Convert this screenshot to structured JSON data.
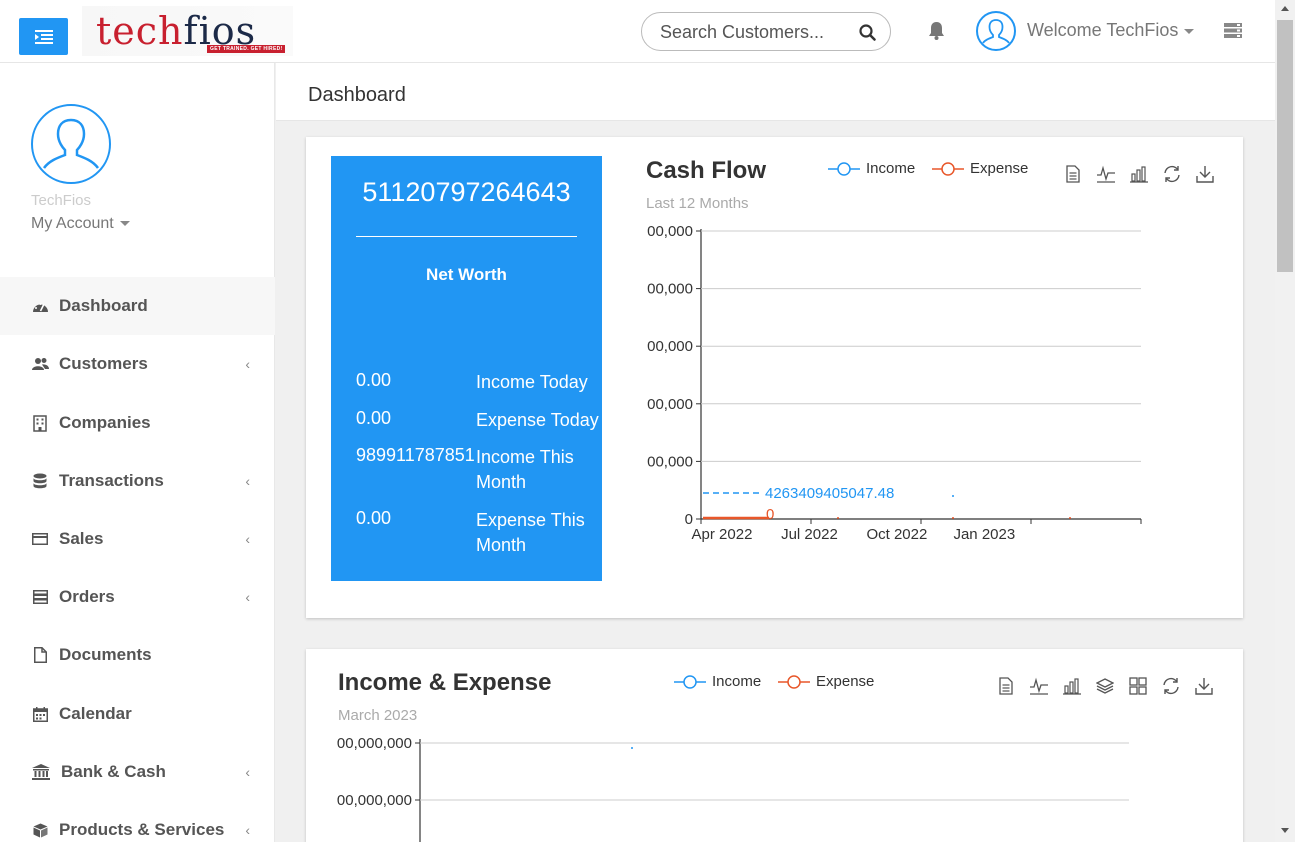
{
  "header": {
    "logo_tech": "tech",
    "logo_fios": "fios",
    "logo_tagline": "GET TRAINED. GET HIRED!",
    "search_placeholder": "Search Customers...",
    "welcome": "Welcome TechFios"
  },
  "sidebar": {
    "profile_name": "TechFios",
    "my_account": "My Account",
    "items": [
      {
        "label": "Dashboard",
        "icon": "dashboard-icon",
        "submenu": false,
        "active": true
      },
      {
        "label": "Customers",
        "icon": "users-icon",
        "submenu": true
      },
      {
        "label": "Companies",
        "icon": "building-icon",
        "submenu": false
      },
      {
        "label": "Transactions",
        "icon": "database-icon",
        "submenu": true
      },
      {
        "label": "Sales",
        "icon": "credit-card-icon",
        "submenu": true
      },
      {
        "label": "Orders",
        "icon": "server-icon",
        "submenu": true
      },
      {
        "label": "Documents",
        "icon": "file-icon",
        "submenu": false
      },
      {
        "label": "Calendar",
        "icon": "calendar-icon",
        "submenu": false
      },
      {
        "label": "Bank & Cash",
        "icon": "bank-icon",
        "submenu": true
      },
      {
        "label": "Products & Services",
        "icon": "cube-icon",
        "submenu": true
      }
    ],
    "submenu_chevron": "‹"
  },
  "breadcrumb": "Dashboard",
  "net_worth": {
    "value": "51120797264643",
    "label": "Net Worth",
    "rows": [
      {
        "value": "0.00",
        "label": "Income Today"
      },
      {
        "value": "0.00",
        "label": "Expense Today"
      },
      {
        "value": "989911787851",
        "label": "Income This Month"
      },
      {
        "value": "0.00",
        "label": "Expense This Month"
      }
    ]
  },
  "colors": {
    "accent": "#2196f3",
    "income": "#2196f3",
    "expense": "#e8572a"
  },
  "chart_data": [
    {
      "type": "line",
      "title": "Cash Flow",
      "subtitle": "Last 12 Months",
      "legend": [
        "Income",
        "Expense"
      ],
      "legend_position": "top",
      "y_tick_labels": [
        "0",
        "00,000",
        "00,000",
        "00,000",
        "00,000",
        "00,000"
      ],
      "x_tick_labels": [
        "Apr 2022",
        "Jul 2022",
        "Oct 2022",
        "Jan 2023"
      ],
      "annotations": [
        {
          "series": "Income",
          "text": "4263409405047.48",
          "style": "dashed"
        },
        {
          "series": "Expense",
          "text": "0"
        }
      ],
      "grid": true
    },
    {
      "type": "line",
      "title": "Income & Expense",
      "subtitle": "March 2023",
      "legend": [
        "Income",
        "Expense"
      ],
      "legend_position": "top",
      "y_tick_labels": [
        "00,000,000",
        "00,000,000"
      ],
      "grid": true
    }
  ]
}
